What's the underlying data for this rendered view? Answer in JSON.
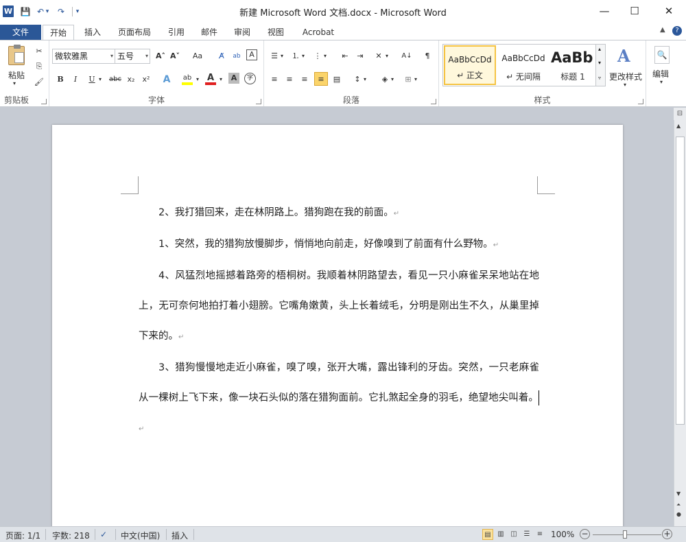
{
  "window": {
    "title": "新建 Microsoft Word 文档.docx - Microsoft Word",
    "app_icon": "W",
    "controls": {
      "minimize": "—",
      "maximize": "☐",
      "close": "✕"
    }
  },
  "quick_access": {
    "save": "💾",
    "undo": "↶",
    "undo_dropdown": "▾",
    "redo": "↷",
    "customize": "▾"
  },
  "tabs": {
    "file": "文件",
    "items": [
      "开始",
      "插入",
      "页面布局",
      "引用",
      "邮件",
      "审阅",
      "视图",
      "Acrobat"
    ],
    "active": "开始",
    "minimize_ribbon": "▲",
    "help": "?"
  },
  "ribbon": {
    "clipboard": {
      "label": "剪贴板",
      "paste": "粘贴",
      "paste_arrow": "▾",
      "cut_icon": "✂",
      "copy_icon": "⎘",
      "format_painter_icon": "🖌"
    },
    "font": {
      "label": "字体",
      "font_name": "微软雅黑",
      "font_size": "五号",
      "grow": "A˄",
      "shrink": "A˅",
      "change_case": "Aa",
      "clear_format": "A̸",
      "phonetic": "ab",
      "char_border": "A",
      "char_shading": "A",
      "enclose": "字",
      "bold": "B",
      "italic": "I",
      "underline": "U",
      "strikethrough": "abc",
      "subscript": "x₂",
      "superscript": "x²",
      "text_effect": "A",
      "highlight": "ab",
      "font_color": "A",
      "font_color_value": "#e02020",
      "highlight_color_value": "#ffff00"
    },
    "paragraph": {
      "label": "段落",
      "bullets": "☰",
      "numbering": "⒈",
      "multilevel": "⋮",
      "decrease_indent": "⇤",
      "increase_indent": "⇥",
      "chinese_layout": "✕",
      "sort": "A↓",
      "show_marks": "¶",
      "align_left": "≡",
      "center": "≡",
      "align_right": "≡",
      "justify": "≡",
      "distributed": "▤",
      "line_spacing": "↕",
      "shading": "◈",
      "borders": "⊞"
    },
    "styles": {
      "label": "样式",
      "items": [
        {
          "preview": "AaBbCcDd",
          "name": "↵ 正文",
          "selected": true
        },
        {
          "preview": "AaBbCcDd",
          "name": "↵ 无间隔",
          "selected": false
        },
        {
          "preview": "AaBb",
          "name": "标题 1",
          "selected": false
        }
      ],
      "change_styles": "更改样式",
      "change_styles_arrow": "▾",
      "gallery_up": "▴",
      "gallery_down": "▾",
      "gallery_more": "▿"
    },
    "editing": {
      "label": "编辑",
      "arrow": "▾",
      "icon": "🔍"
    }
  },
  "document": {
    "paragraphs": [
      "2、我打猎回来，走在林阴路上。猎狗跑在我的前面。",
      "1、突然，我的猎狗放慢脚步，悄悄地向前走，好像嗅到了前面有什么野物。",
      "4、风猛烈地摇撼着路旁的梧桐树。我顺着林阴路望去，看见一只小麻雀呆呆地站在地上，无可奈何地拍打着小翅膀。它嘴角嫩黄，头上长着绒毛，分明是刚出生不久，从巢里掉下来的。",
      "3、猎狗慢慢地走近小麻雀，嗅了嗅，张开大嘴，露出锋利的牙齿。突然，一只老麻雀从一棵树上飞下来，像一块石头似的落在猎狗面前。它扎煞起全身的羽毛，绝望地尖叫着。"
    ],
    "paragraph_mark": "↵"
  },
  "statusbar": {
    "page": "页面: 1/1",
    "words": "字数: 218",
    "proof_icon": "✓",
    "language": "中文(中国)",
    "mode": "插入",
    "zoom": "100%",
    "zoom_out": "−",
    "zoom_in": "+"
  }
}
